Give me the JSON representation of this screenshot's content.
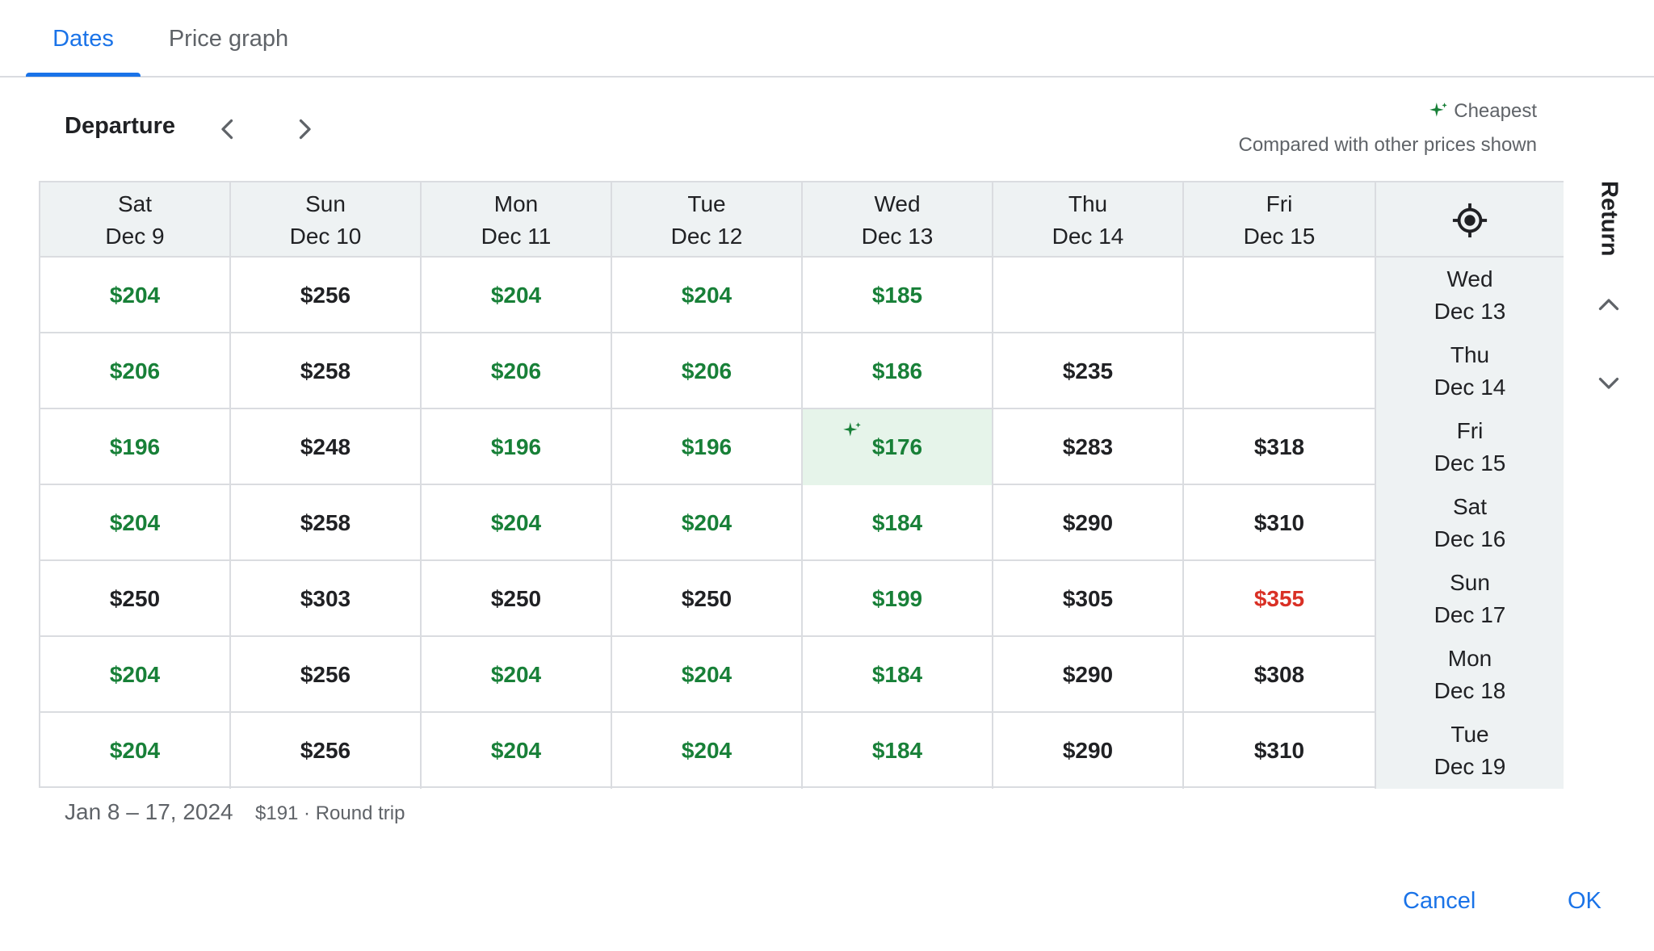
{
  "tabs": [
    "Dates",
    "Price graph"
  ],
  "departure_label": "Departure",
  "legend": {
    "cheapest_label": "Cheapest",
    "note": "Compared with other prices shown"
  },
  "columns": [
    {
      "day": "Sat",
      "date": "Dec 9"
    },
    {
      "day": "Sun",
      "date": "Dec 10"
    },
    {
      "day": "Mon",
      "date": "Dec 11"
    },
    {
      "day": "Tue",
      "date": "Dec 12"
    },
    {
      "day": "Wed",
      "date": "Dec 13"
    },
    {
      "day": "Thu",
      "date": "Dec 14"
    },
    {
      "day": "Fri",
      "date": "Dec 15"
    }
  ],
  "rows": [
    {
      "day": "Wed",
      "date": "Dec 13",
      "prices": [
        "$204",
        "$256",
        "$204",
        "$204",
        "$185",
        "",
        ""
      ]
    },
    {
      "day": "Thu",
      "date": "Dec 14",
      "prices": [
        "$206",
        "$258",
        "$206",
        "$206",
        "$186",
        "$235",
        ""
      ]
    },
    {
      "day": "Fri",
      "date": "Dec 15",
      "prices": [
        "$196",
        "$248",
        "$196",
        "$196",
        "$176",
        "$283",
        "$318"
      ]
    },
    {
      "day": "Sat",
      "date": "Dec 16",
      "prices": [
        "$204",
        "$258",
        "$204",
        "$204",
        "$184",
        "$290",
        "$310"
      ]
    },
    {
      "day": "Sun",
      "date": "Dec 17",
      "prices": [
        "$250",
        "$303",
        "$250",
        "$250",
        "$199",
        "$305",
        "$355"
      ]
    },
    {
      "day": "Mon",
      "date": "Dec 18",
      "prices": [
        "$204",
        "$256",
        "$204",
        "$204",
        "$184",
        "$290",
        "$308"
      ]
    },
    {
      "day": "Tue",
      "date": "Dec 19",
      "prices": [
        "$204",
        "$256",
        "$204",
        "$204",
        "$184",
        "$290",
        "$310"
      ]
    }
  ],
  "price_levels": [
    [
      "green",
      "black",
      "green",
      "green",
      "green",
      "",
      ""
    ],
    [
      "green",
      "black",
      "green",
      "green",
      "green",
      "black",
      ""
    ],
    [
      "green",
      "black",
      "green",
      "green",
      "green",
      "black",
      "black"
    ],
    [
      "green",
      "black",
      "green",
      "green",
      "green",
      "black",
      "black"
    ],
    [
      "black",
      "black",
      "black",
      "black",
      "green",
      "black",
      "red"
    ],
    [
      "green",
      "black",
      "green",
      "green",
      "green",
      "black",
      "black"
    ],
    [
      "green",
      "black",
      "green",
      "green",
      "green",
      "black",
      "black"
    ]
  ],
  "cheapest_cell": {
    "row": 2,
    "col": 4
  },
  "return_label": "Return",
  "selected": {
    "dates": "Jan 8 – 17, 2024",
    "price": "$191 · Round trip"
  },
  "buttons": {
    "cancel": "Cancel",
    "ok": "OK"
  },
  "colors": {
    "accent": "#1a73e8",
    "low_price": "#188038",
    "high_price": "#d93025",
    "cheapest_bg": "#e6f4ea",
    "header_bg": "#eef2f3"
  },
  "icons": {
    "prev": "chevron-left-icon",
    "next": "chevron-right-icon",
    "cheapest": "sparkle-icon",
    "current": "gps-target-icon",
    "up": "chevron-up-icon",
    "down": "chevron-down-icon"
  }
}
